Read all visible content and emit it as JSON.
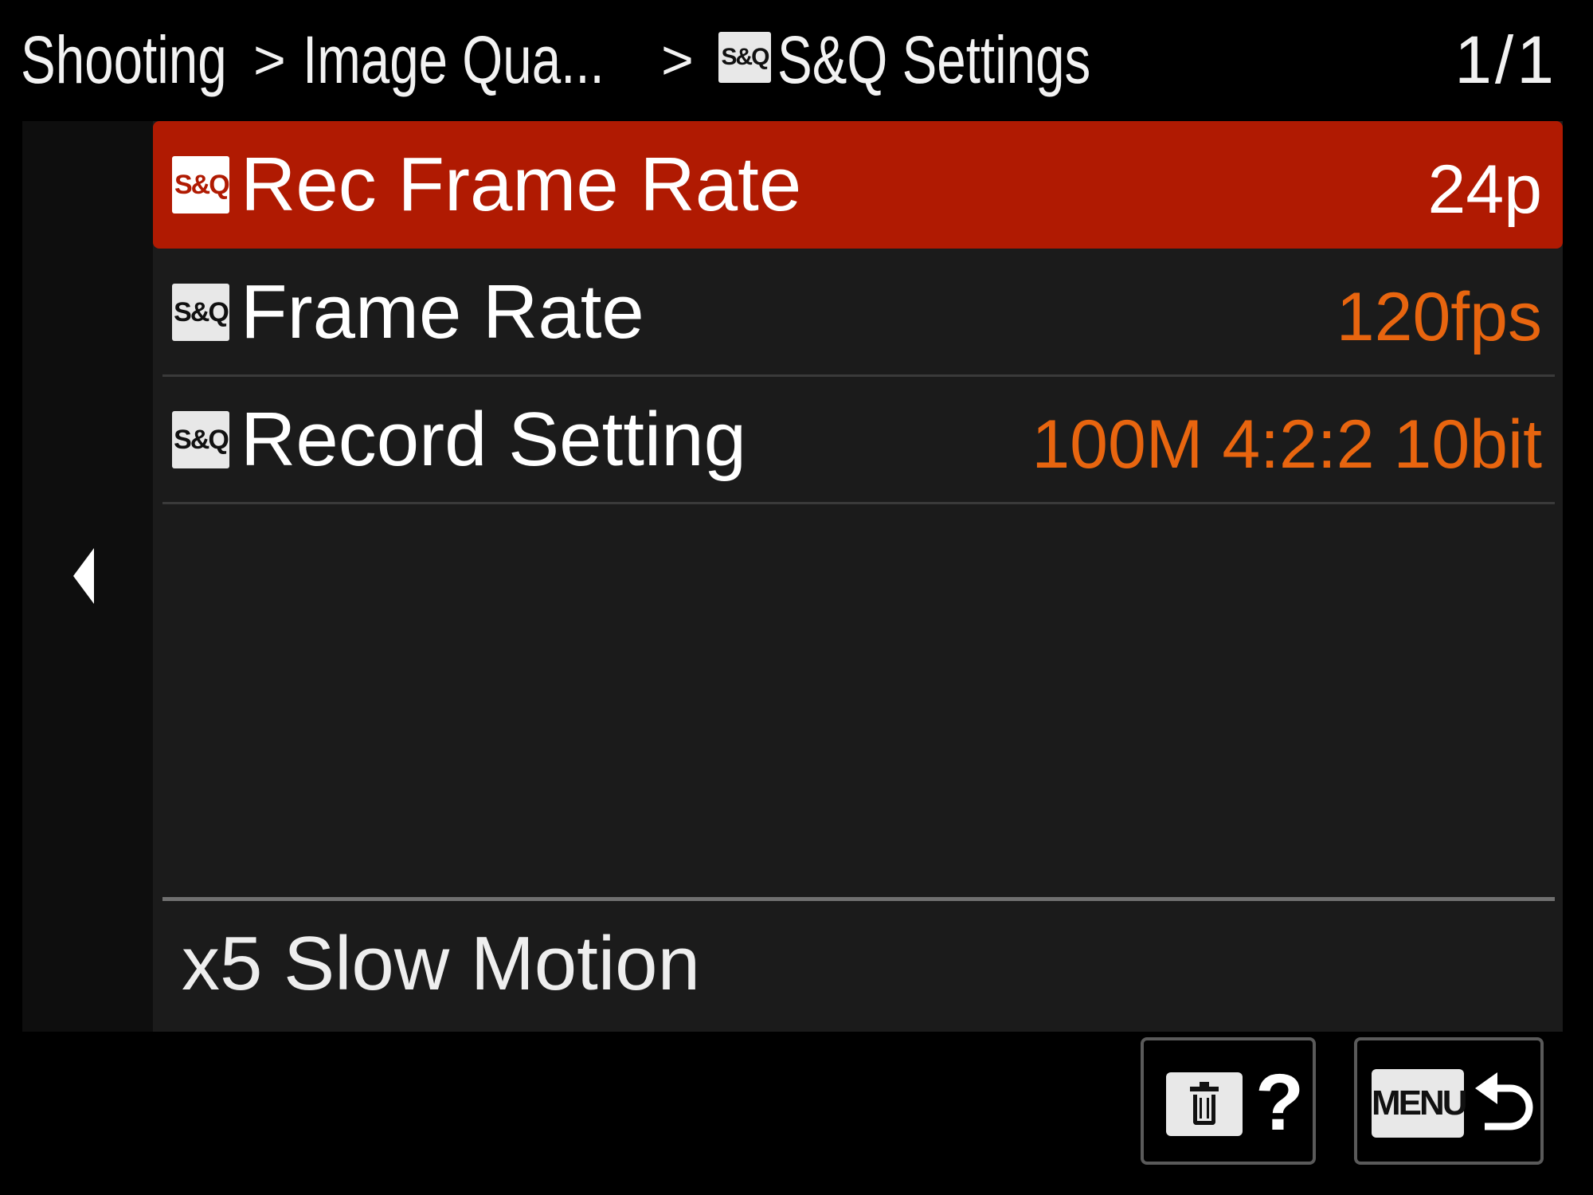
{
  "header": {
    "breadcrumb": [
      {
        "label": "Shooting"
      },
      {
        "label": "Image Qua..."
      },
      {
        "label": "S&Q Settings"
      }
    ],
    "separator": ">",
    "page_indicator": "1/1"
  },
  "icons": {
    "sq_badge": "S&Q",
    "menu_badge": "MENU",
    "help_mark": "?"
  },
  "menu": {
    "items": [
      {
        "label": "Rec Frame Rate",
        "value": "24p",
        "selected": true
      },
      {
        "label": "Frame Rate",
        "value": "120fps",
        "selected": false
      },
      {
        "label": "Record Setting",
        "value": "100M 4:2:2 10bit",
        "selected": false
      }
    ]
  },
  "description": "x5 Slow Motion",
  "colors": {
    "selected_row": "#b01a02",
    "value_text": "#e8650f",
    "panel_bg": "#1b1b1b",
    "background": "#000000"
  }
}
